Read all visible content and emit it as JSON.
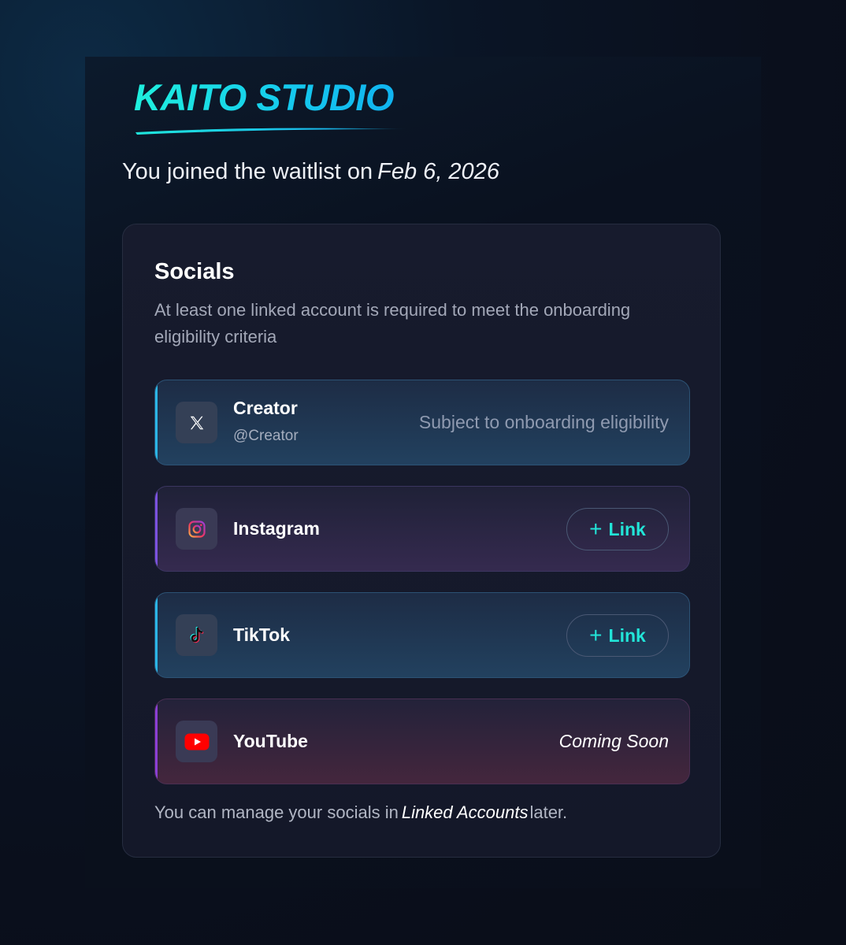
{
  "brand": {
    "name": "KAITO STUDIO",
    "accent": "#19e2e6"
  },
  "waitlist": {
    "prefix": "You joined the waitlist on",
    "date": "Feb 6, 2026"
  },
  "socials": {
    "title": "Socials",
    "description": "At least one linked account is required to meet the onboarding eligibility criteria",
    "accounts": [
      {
        "platform": "X",
        "icon": "x-logo-icon",
        "name": "Creator",
        "handle": "@Creator",
        "status": "Subject to onboarding eligibility"
      },
      {
        "platform": "Instagram",
        "icon": "instagram-icon",
        "name": "Instagram",
        "action_plus": "+",
        "action_label": "Link"
      },
      {
        "platform": "TikTok",
        "icon": "tiktok-icon",
        "name": "TikTok",
        "action_plus": "+",
        "action_label": "Link"
      },
      {
        "platform": "YouTube",
        "icon": "youtube-icon",
        "name": "YouTube",
        "status": "Coming Soon"
      }
    ],
    "footer": {
      "prefix": "You can manage your socials in",
      "link_text": "Linked Accounts",
      "suffix": "later."
    }
  }
}
